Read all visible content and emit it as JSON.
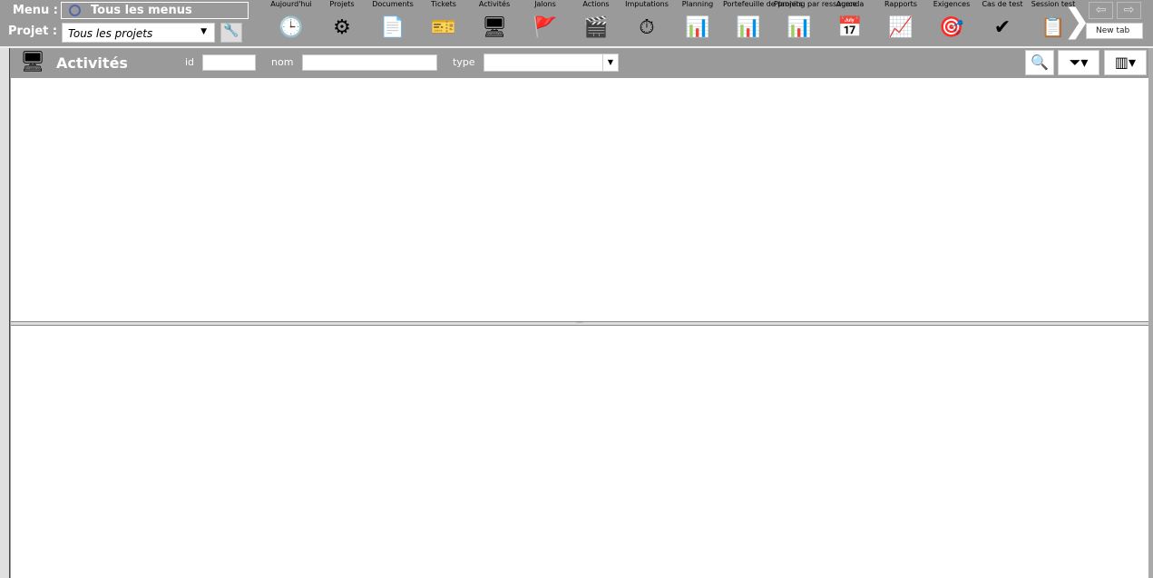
{
  "top": {
    "menu_label": "Menu :",
    "menu_value": "Tous les menus",
    "project_label": "Projet :",
    "project_value": "Tous les projets",
    "new_tab": "New tab"
  },
  "toolbar": [
    {
      "label": "Aujourd'hui",
      "icon": "🕒"
    },
    {
      "label": "Projets",
      "icon": "⚙"
    },
    {
      "label": "Documents",
      "icon": "📄"
    },
    {
      "label": "Tickets",
      "icon": "🎫"
    },
    {
      "label": "Activités",
      "icon": "🖥"
    },
    {
      "label": "Jalons",
      "icon": "🚩"
    },
    {
      "label": "Actions",
      "icon": "🎬"
    },
    {
      "label": "Imputations",
      "icon": "⏱"
    },
    {
      "label": "Planning",
      "icon": "📊"
    },
    {
      "label": "Portefeuille de projets",
      "icon": "📊"
    },
    {
      "label": "Planning par ressource",
      "icon": "📊"
    },
    {
      "label": "Agenda",
      "icon": "📅"
    },
    {
      "label": "Rapports",
      "icon": "📈"
    },
    {
      "label": "Exigences",
      "icon": "🎯"
    },
    {
      "label": "Cas de test",
      "icon": "✔"
    },
    {
      "label": "Session test",
      "icon": "📋"
    }
  ],
  "header": {
    "title": "Activités",
    "id_label": "id",
    "name_label": "nom",
    "type_label": "type",
    "id_value": "",
    "name_value": "",
    "type_value": ""
  }
}
